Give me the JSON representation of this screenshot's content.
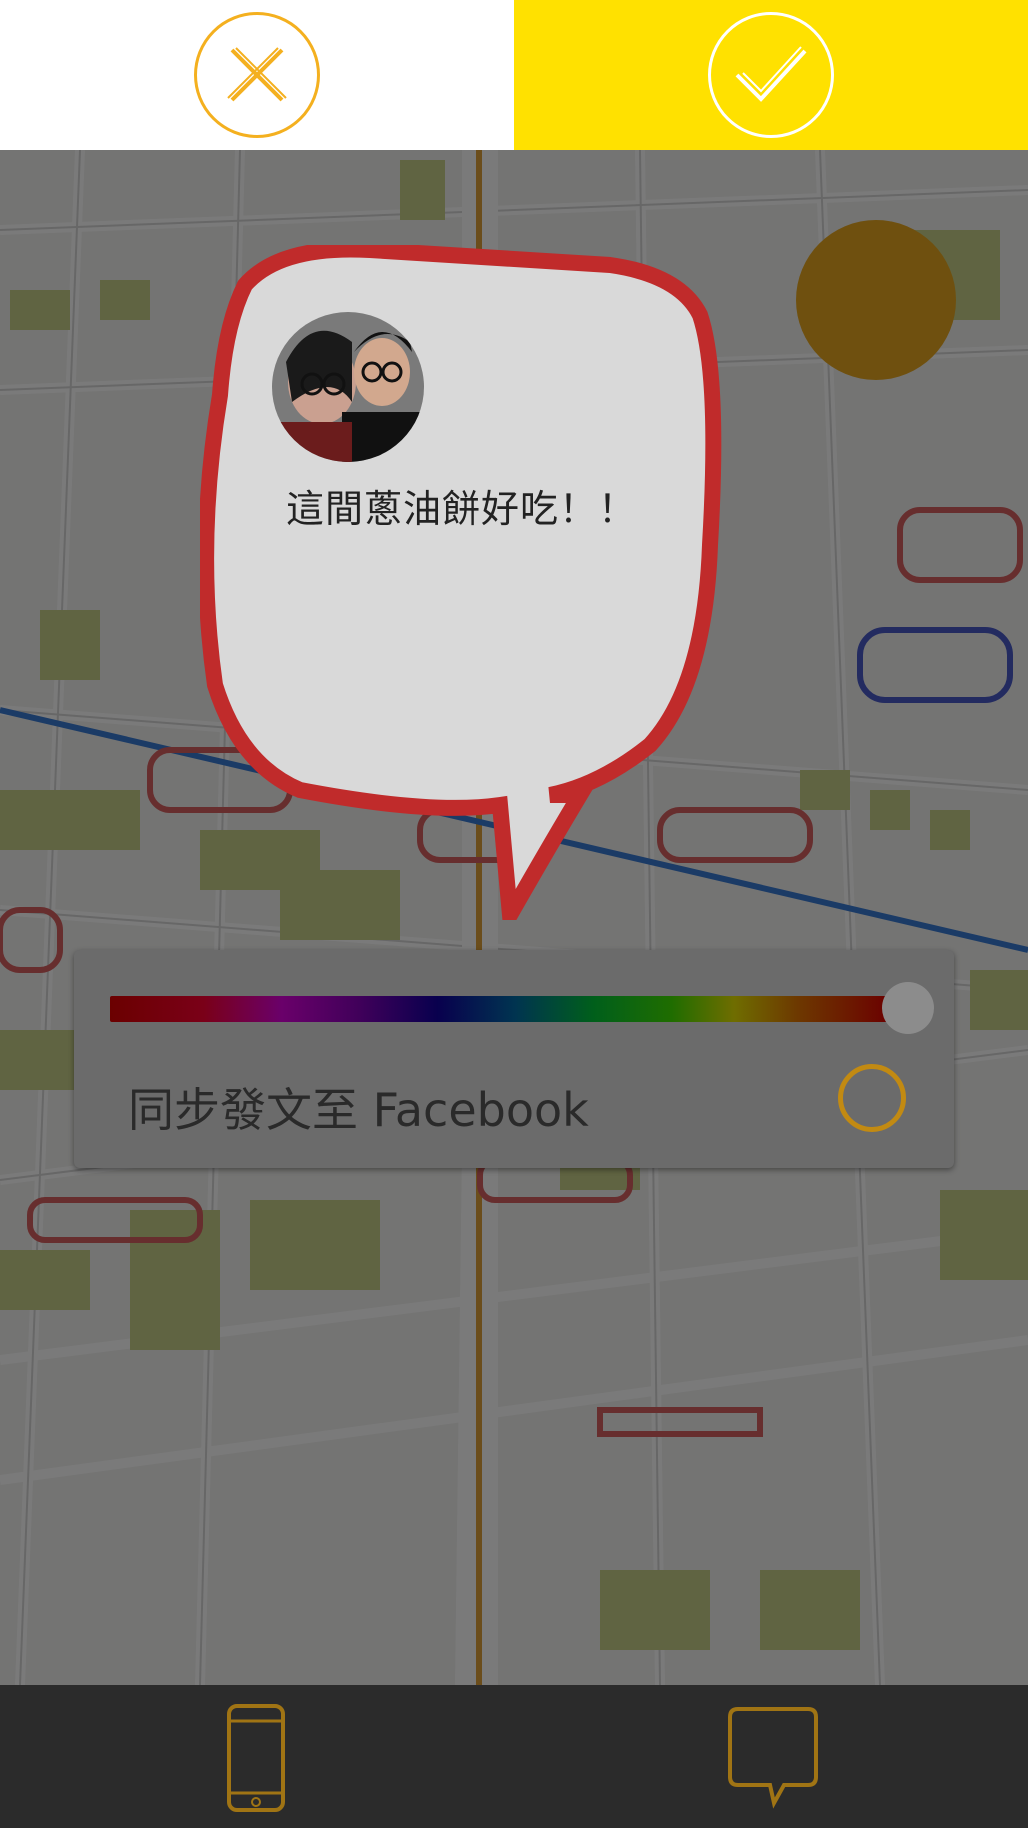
{
  "topbar": {
    "cancel_icon": "close-icon",
    "confirm_icon": "check-icon",
    "accent_color": "#ffe100",
    "cancel_color": "#f4b01f"
  },
  "post": {
    "message": "這間蔥油餅好吃！！",
    "bubble_color": "#d63030",
    "avatar_icon": "user-avatar"
  },
  "options": {
    "color_slider_icon": "color-slider",
    "sync_label": "同步發文至 Facebook",
    "sync_toggle_icon": "circle-toggle"
  },
  "bottombar": {
    "left_icon": "phone-icon",
    "right_icon": "speech-bubble-icon"
  }
}
